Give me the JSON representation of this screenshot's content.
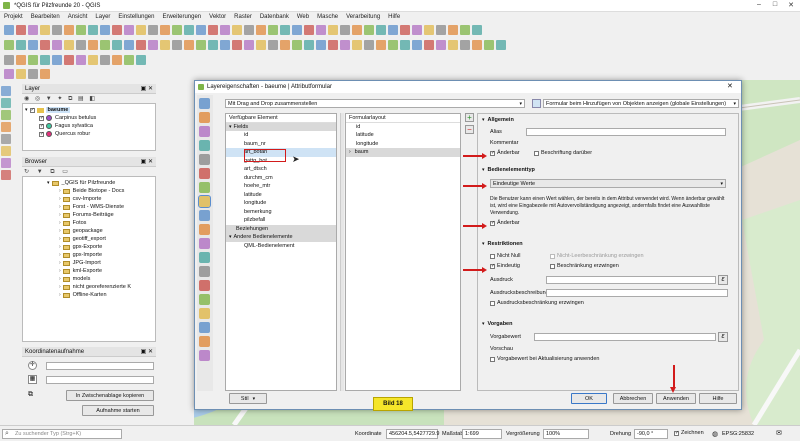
{
  "window": {
    "title": "*QGIS für Pilzfreunde 20 - QGIS"
  },
  "menu": [
    "Projekt",
    "Bearbeiten",
    "Ansicht",
    "Layer",
    "Einstellungen",
    "Erweiterungen",
    "Vektor",
    "Raster",
    "Datenbank",
    "Web",
    "Masche",
    "Verarbeitung",
    "Hilfe"
  ],
  "layers_panel": {
    "title": "Layer",
    "group": "baeume",
    "items": [
      {
        "label": "Carpinus betulus",
        "color": "#9b4fc8"
      },
      {
        "label": "Fagus sylvatica",
        "color": "#3ec9a0"
      },
      {
        "label": "Quercus robur",
        "color": "#e0307a"
      }
    ]
  },
  "browser_panel": {
    "title": "Browser",
    "root": "_QGIS für Pilzfreunde",
    "items": [
      "Beide Biotope - Docs",
      "csv-Importe",
      "Forst - WMS-Dienste",
      "Forums-Beiträge",
      "Fotos",
      "geopackage",
      "geotiff_export",
      "gpx-Exporte",
      "gpx-Importe",
      "JPG-Import",
      "kml-Exporte",
      "models",
      "nicht georeferenzierte K",
      "Offline-Karten"
    ]
  },
  "coord_panel": {
    "title": "Koordinatenaufnahme",
    "copy_button": "In Zwischenablage kopieren",
    "capture_button": "Aufnahme starten"
  },
  "dialog": {
    "title": "Layereigenschaften - baeume | Attributformular",
    "mode_combo": "Mit Drag and Drop zusammenstellen",
    "form_combo": "Formular beim Hinzufügen von Objekten anzeigen (globale Einstellungen)",
    "available_header": "Verfügbare Element",
    "available": {
      "fields_label": "Fields",
      "fields": [
        "id",
        "baum_nr",
        "art_botan",
        "gattg_bot",
        "art_dtsch",
        "durchm_cm",
        "hoehe_mtr",
        "latitude",
        "longitude",
        "bemerkung",
        "pilzbefall"
      ],
      "relations_label": "Beziehungen",
      "others_label": "Andere Bedienelemente",
      "others": [
        "QML-Bedienelement"
      ]
    },
    "layout_header": "Formularlayout",
    "layout": [
      "id",
      "latitude",
      "longitude",
      "baum"
    ],
    "general": {
      "title": "Allgemein",
      "alias_label": "Alias",
      "comment_label": "Kommentar",
      "editable_label": "Änderbar",
      "label_on_top": "Beschriftung darüber"
    },
    "widget": {
      "title": "Bedienelementtyp",
      "combo": "Eindeutige Werte",
      "description": "Die Benutzer kann einen Wert wählen, der bereits in dem Attribut verwendet wird. Wenn änderbar gewählt ist, wird eine Eingabezeile mit Autovervollständigung angezeigt, andernfalls findet eine Auswahlliste Verwendung.",
      "editable_label": "Änderbar"
    },
    "constraints": {
      "title": "Restriktionen",
      "not_null": "Nicht Null",
      "not_null_enforce": "Nicht-Leerbeschränkung erzwingen",
      "unique": "Eindeutig",
      "unique_enforce": "Beschränkung erzwingen",
      "expression": "Ausdruck",
      "expression_desc": "Ausdrucksbeschreibung",
      "expression_enforce": "Ausdrucksbeschränkung erzwingen"
    },
    "defaults": {
      "title": "Vorgaben",
      "default_value": "Vorgabewert",
      "preview": "Vorschau",
      "apply_on_update": "Vorgabewert bei Aktualisierung anwenden"
    },
    "buttons": {
      "style": "Stil",
      "ok": "OK",
      "cancel": "Abbrechen",
      "apply": "Anwenden",
      "help": "Hilfe"
    }
  },
  "caption": "Bild 18",
  "status": {
    "search_placeholder": "Zu suchender Typ (Strg+K)",
    "coord_label": "Koordinate",
    "coord_value": "456204.5,5427729.9",
    "scale_label": "Maßstab",
    "scale_value": "1:699",
    "magnifier_label": "Vergrößerung",
    "magnifier_value": "100%",
    "rotation_label": "Drehung",
    "rotation_value": "-90,0 °",
    "render_label": "Zeichnen",
    "crs": "EPSG:25832"
  }
}
